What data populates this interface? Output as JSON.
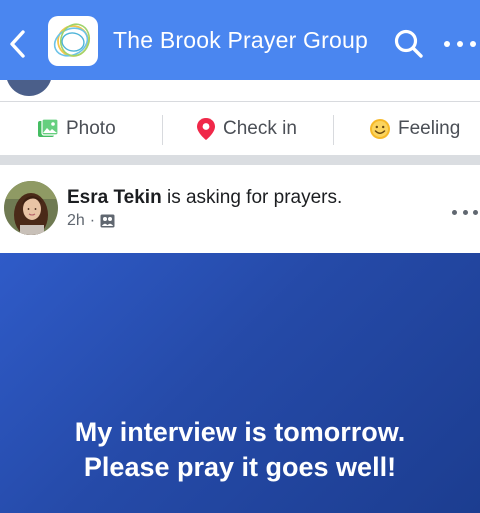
{
  "header": {
    "title": "The Brook Prayer Group",
    "background": "#4a86f0",
    "icons": {
      "back": "chevron-left-icon",
      "search": "search-icon",
      "more": "more-horizontal-icon"
    }
  },
  "composer": {
    "actions": [
      {
        "label": "Photo",
        "icon": "photo-icon",
        "color": "#45bd62"
      },
      {
        "label": "Check in",
        "icon": "location-pin-icon",
        "color": "#f02849"
      },
      {
        "label": "Feeling",
        "icon": "smiley-icon",
        "color": "#f7b928"
      }
    ]
  },
  "post": {
    "author": "Esra Tekin",
    "action_text": " is asking for prayers.",
    "time": "2h",
    "separator": "·",
    "audience_icon": "group-audience-icon",
    "prayer_lines": [
      "My interview is tomorrow.",
      "Please pray it goes well!"
    ],
    "card_color": "#254aa8"
  }
}
